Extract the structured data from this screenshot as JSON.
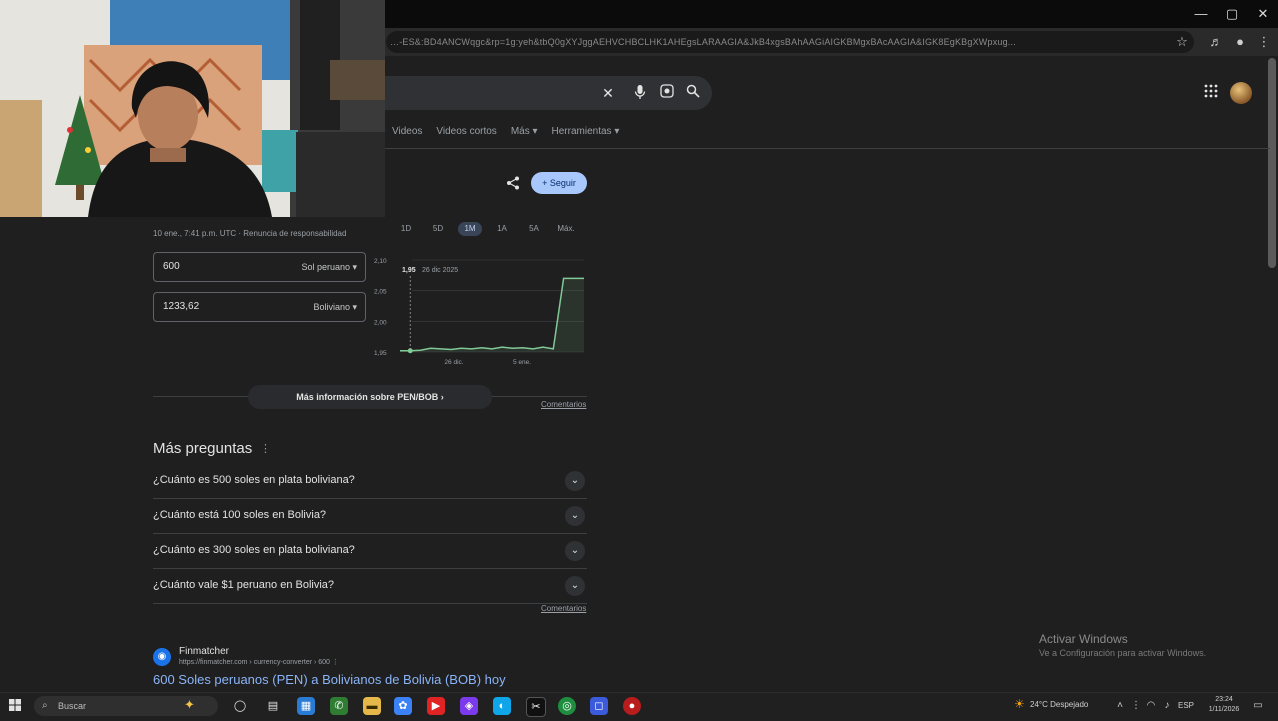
{
  "browser": {
    "url": "…-ES&:BD4ANCWqgc&rp=1g:yeh&tbQ0gXYJggAEHVCHBCLHK1AHEgsLARAAGIA&JkB4xgsBAhAAGiAIGKBMgxBAcAAGIA&IGK8EgKBgXWpxug...",
    "window_controls": [
      "—",
      "▢",
      "✕"
    ]
  },
  "search": {
    "tabs": [
      "Videos",
      "Videos cortos",
      "Más ▾",
      "Herramientas ▾"
    ]
  },
  "converter": {
    "follow_label": "+ Seguir",
    "timestamp": "10 ene., 7:41 p.m. UTC · Renuncia de responsabilidad",
    "ranges": [
      "1D",
      "5D",
      "1M",
      "1A",
      "5A",
      "Máx."
    ],
    "active_range": "1M",
    "from_amount": "600",
    "from_currency": "Sol peruano ▾",
    "to_amount": "1233,62",
    "to_currency": "Boliviano ▾",
    "more_info": "Más información sobre PEN/BOB  ›",
    "feedback": "Comentarios"
  },
  "chart_data": {
    "type": "line",
    "y_ticks": [
      "2,10",
      "2,05",
      "2,00",
      "1,95"
    ],
    "x_ticks": [
      "26 dic.",
      "5 ene."
    ],
    "hover_value": "1,95",
    "hover_date": "26 dic 2025",
    "ylim": [
      1.95,
      2.1
    ],
    "series": [
      {
        "values": [
          1.952,
          1.952,
          1.953,
          1.956,
          1.955,
          1.954,
          1.956,
          1.955,
          1.957,
          1.955,
          1.958,
          1.956,
          1.957,
          1.955,
          1.958,
          1.955,
          2.07,
          2.07,
          2.07
        ]
      }
    ],
    "line_color": "#81c995",
    "grid": true
  },
  "paa": {
    "heading": "Más preguntas",
    "more_icon": "⋮",
    "questions": [
      "¿Cuánto es 500 soles en plata boliviana?",
      "¿Cuánto está 100 soles en Bolivia?",
      "¿Cuánto es 300 soles en plata boliviana?",
      "¿Cuánto vale $1 peruano en Bolivia?"
    ],
    "feedback": "Comentarios"
  },
  "result": {
    "source_name": "Finmatcher",
    "source_url": "https://finmatcher.com › currency-converter › 600 ⋮",
    "title": "600 Soles peruanos (PEN) a Bolivianos de Bolivia (BOB) hoy"
  },
  "watermark": {
    "title": "Activar Windows",
    "subtitle": "Ve a Configuración para activar Windows."
  },
  "taskbar": {
    "search_label": "Buscar",
    "weather": "24°C  Despejado",
    "time": "23:24",
    "date": "1/11/2026",
    "lang": "ESP"
  },
  "colors": {
    "accent_blue": "#a8c7fa",
    "link": "#8ab4f8",
    "background": "#1f1f1f"
  }
}
